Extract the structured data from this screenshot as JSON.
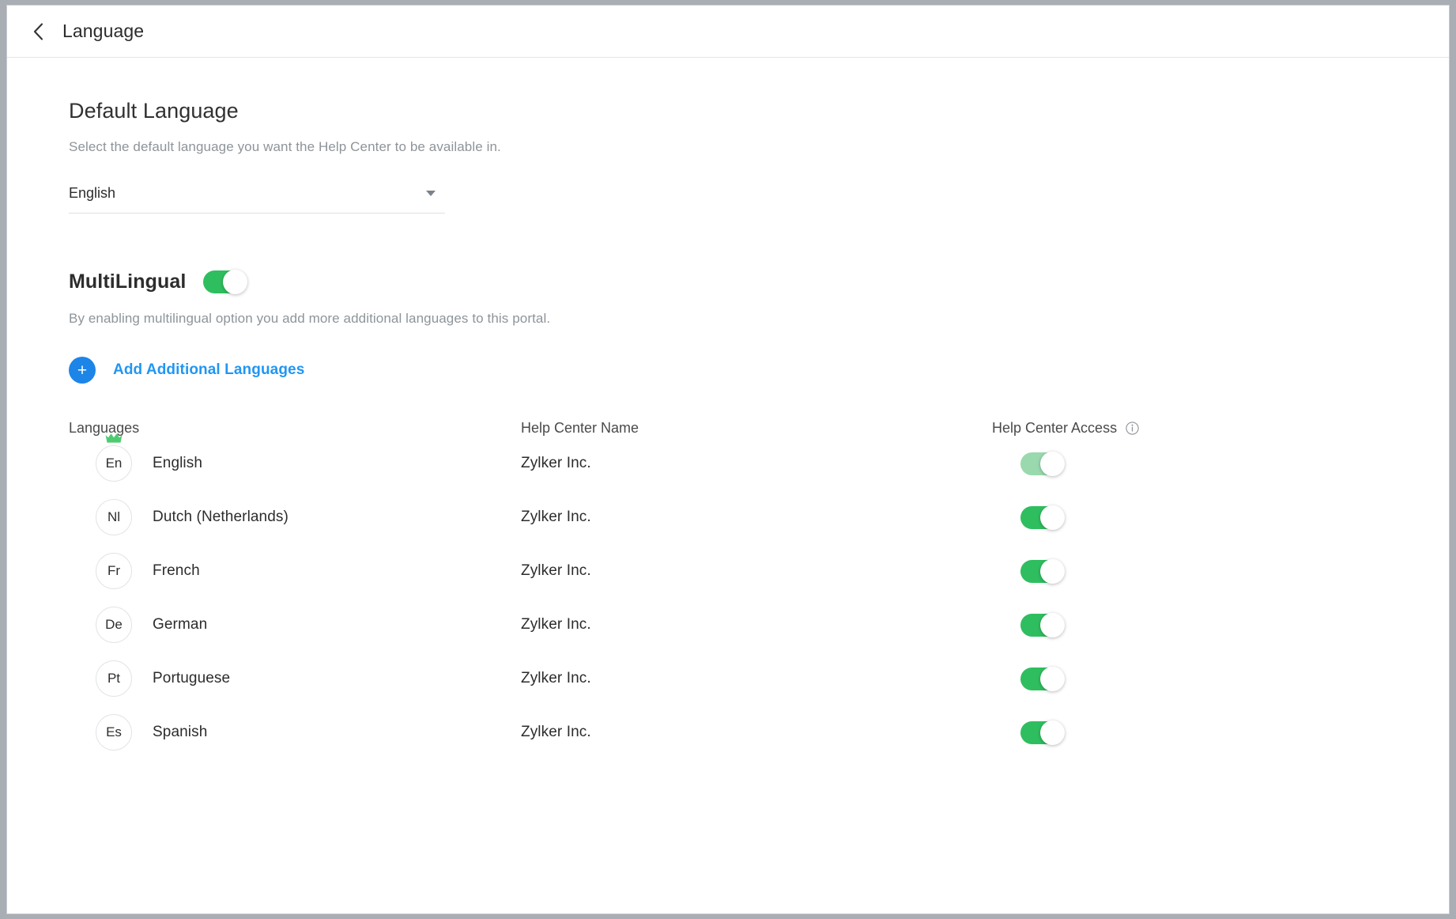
{
  "header": {
    "back_icon": "chevron-left-icon",
    "title": "Language"
  },
  "default_language": {
    "title": "Default Language",
    "description": "Select the default language you want the Help Center to be available in.",
    "selected": "English",
    "caret_icon": "chevron-down-icon"
  },
  "multilingual": {
    "title": "MultiLingual",
    "enabled": true,
    "description": "By enabling multilingual option you add more additional languages to this portal.",
    "add_button": {
      "icon": "plus-icon",
      "label": "Add Additional Languages"
    }
  },
  "table": {
    "columns": {
      "languages": "Languages",
      "help_center_name": "Help Center Name",
      "help_center_access": "Help Center Access",
      "access_info_icon": "info-icon"
    },
    "rows": [
      {
        "code": "En",
        "language": "English",
        "help_center_name": "Zylker Inc.",
        "access_enabled": true,
        "access_locked": true,
        "is_default": true,
        "crown_icon": "crown-icon"
      },
      {
        "code": "Nl",
        "language": "Dutch (Netherlands)",
        "help_center_name": "Zylker Inc.",
        "access_enabled": true,
        "access_locked": false,
        "is_default": false,
        "crown_icon": ""
      },
      {
        "code": "Fr",
        "language": "French",
        "help_center_name": "Zylker Inc.",
        "access_enabled": true,
        "access_locked": false,
        "is_default": false,
        "crown_icon": ""
      },
      {
        "code": "De",
        "language": "German",
        "help_center_name": "Zylker Inc.",
        "access_enabled": true,
        "access_locked": false,
        "is_default": false,
        "crown_icon": ""
      },
      {
        "code": "Pt",
        "language": "Portuguese",
        "help_center_name": "Zylker Inc.",
        "access_enabled": true,
        "access_locked": false,
        "is_default": false,
        "crown_icon": ""
      },
      {
        "code": "Es",
        "language": "Spanish",
        "help_center_name": "Zylker Inc.",
        "access_enabled": true,
        "access_locked": false,
        "is_default": false,
        "crown_icon": ""
      }
    ]
  },
  "colors": {
    "toggle_on": "#2fbe5f",
    "toggle_on_muted": "#9ad9ae",
    "link_blue": "#2196f3",
    "plus_blue": "#1d85e8",
    "crown_green": "#4ecb71"
  }
}
